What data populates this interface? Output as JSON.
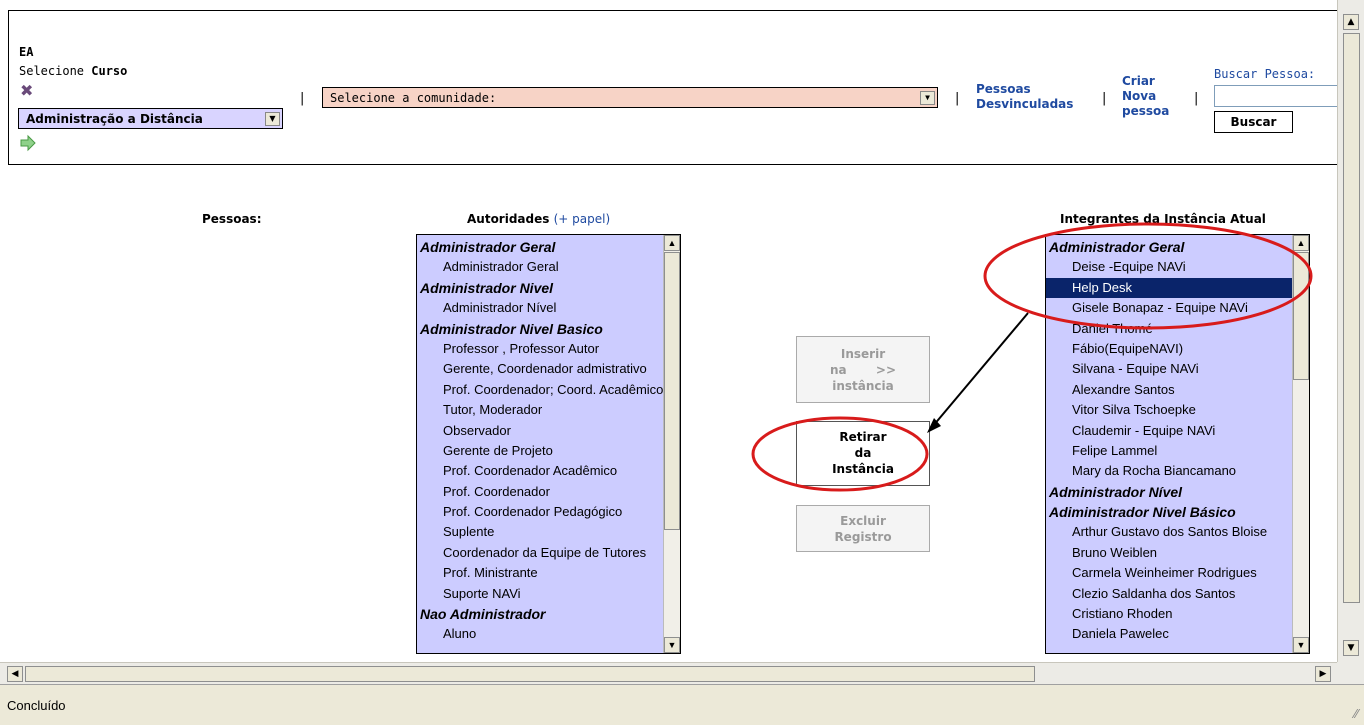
{
  "header": {
    "ea_label": "EA",
    "select_prefix": "Selecione ",
    "select_curso": "Curso",
    "curso_value": "Administração a Distância",
    "comunidade_value": "Selecione a comunidade:",
    "sep": "|",
    "link_desvinculadas": "Pessoas Desvinculadas",
    "link_criar": "Criar Nova pessoa",
    "buscar_label": "Buscar Pessoa:",
    "buscar_value": "",
    "buscar_button": "Buscar"
  },
  "columns": {
    "pessoas": "Pessoas:",
    "autoridades": "Autoridades",
    "papel": "(+ papel)",
    "integrantes": "Integrantes da Instância Atual"
  },
  "autoridades_list": [
    {
      "text": "Administrador Geral",
      "group": true
    },
    {
      "text": "Administrador Geral",
      "group": false
    },
    {
      "text": "Administrador Nivel",
      "group": true
    },
    {
      "text": "Administrador Nível",
      "group": false
    },
    {
      "text": "Administrador Nivel Basico",
      "group": true
    },
    {
      "text": "Professor , Professor Autor",
      "group": false
    },
    {
      "text": "Gerente, Coordenador admistrativo",
      "group": false
    },
    {
      "text": "Prof. Coordenador; Coord. Acadêmico",
      "group": false
    },
    {
      "text": "Tutor, Moderador",
      "group": false
    },
    {
      "text": "Observador",
      "group": false
    },
    {
      "text": "Gerente de Projeto",
      "group": false
    },
    {
      "text": "Prof. Coordenador Acadêmico",
      "group": false
    },
    {
      "text": "Prof. Coordenador",
      "group": false
    },
    {
      "text": "Prof. Coordenador Pedagógico",
      "group": false
    },
    {
      "text": "Suplente",
      "group": false
    },
    {
      "text": "Coordenador da Equipe de Tutores",
      "group": false
    },
    {
      "text": "Prof. Ministrante",
      "group": false
    },
    {
      "text": "Suporte NAVi",
      "group": false
    },
    {
      "text": "Nao Administrador",
      "group": true
    },
    {
      "text": "Aluno",
      "group": false
    }
  ],
  "integrantes_list": [
    {
      "text": "Administrador Geral",
      "group": true
    },
    {
      "text": "Deise -Equipe NAVi",
      "group": false
    },
    {
      "text": "Help Desk",
      "group": false,
      "selected": true
    },
    {
      "text": "Gisele Bonapaz - Equipe NAVi",
      "group": false
    },
    {
      "text": "Daniel Thomé",
      "group": false
    },
    {
      "text": "Fábio(EquipeNAVI)",
      "group": false
    },
    {
      "text": "Silvana - Equipe NAVi",
      "group": false
    },
    {
      "text": "Alexandre Santos",
      "group": false
    },
    {
      "text": "Vitor Silva Tschoepke",
      "group": false
    },
    {
      "text": "Claudemir - Equipe NAVi",
      "group": false
    },
    {
      "text": "Felipe Lammel",
      "group": false
    },
    {
      "text": "Mary da Rocha Biancamano",
      "group": false
    },
    {
      "text": "Administrador Nível",
      "group": true
    },
    {
      "text": "Adiministrador Nivel Básico",
      "group": true
    },
    {
      "text": "Arthur Gustavo dos Santos Bloise",
      "group": false
    },
    {
      "text": "Bruno Weiblen",
      "group": false
    },
    {
      "text": "Carmela Weinheimer Rodrigues",
      "group": false
    },
    {
      "text": "Clezio Saldanha dos Santos",
      "group": false
    },
    {
      "text": "Cristiano Rhoden",
      "group": false
    },
    {
      "text": "Daniela Pawelec",
      "group": false
    }
  ],
  "actions": {
    "inserir": [
      "Inserir",
      "na       >>",
      "instância"
    ],
    "retirar": [
      "Retirar",
      "da",
      "Instância"
    ],
    "excluir": [
      "Excluir",
      "Registro"
    ]
  },
  "status": {
    "text": "Concluído"
  },
  "colors": {
    "listbox_bg": "#ccccff",
    "link": "#1f4aa0",
    "annotation_red": "#d81b1b",
    "selection": "#0a246a"
  }
}
